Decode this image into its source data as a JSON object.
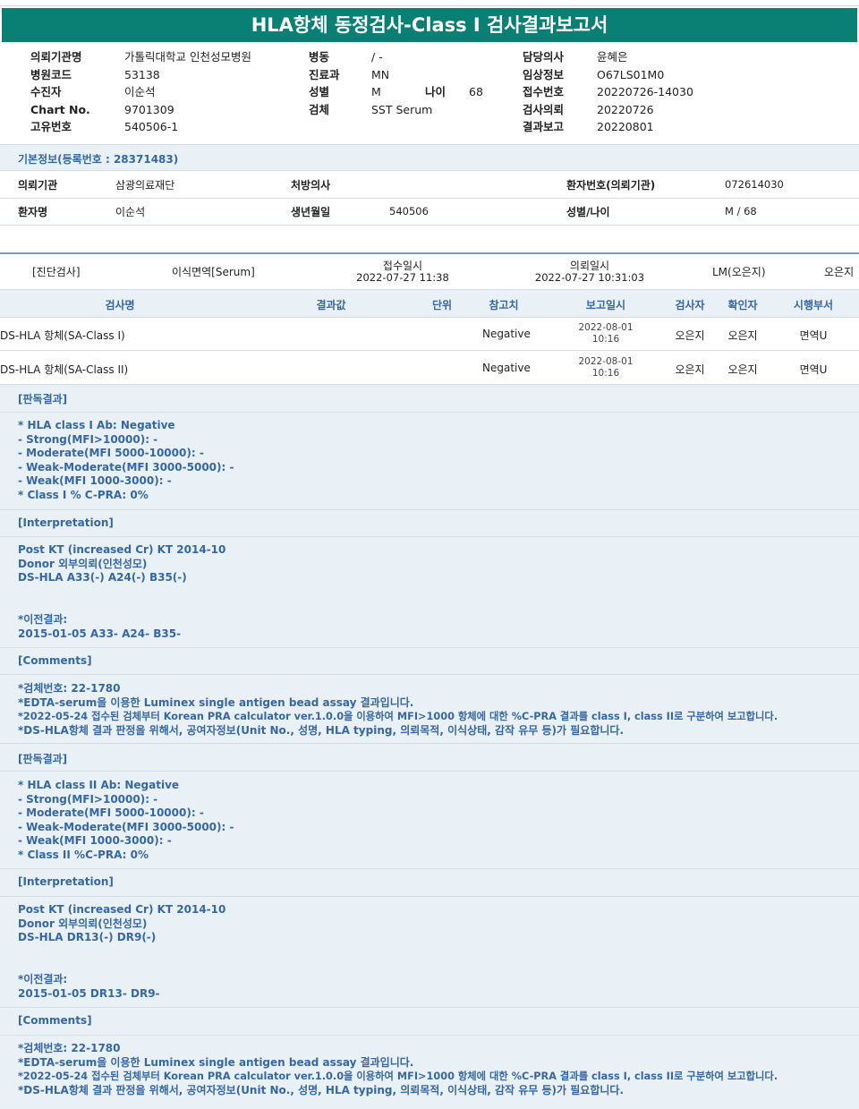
{
  "report_title": "HLA항체 동정검사-Class I 검사결과보고서",
  "header": {
    "col1": [
      {
        "label": "의뢰기관명",
        "value": "가톨릭대학교 인천성모병원"
      },
      {
        "label": "병원코드",
        "value": "53138"
      },
      {
        "label": "수진자",
        "value": "이순석"
      },
      {
        "label": "Chart No.",
        "value": "9701309"
      },
      {
        "label": "고유번호",
        "value": "540506-1"
      }
    ],
    "col2": [
      {
        "label": "병동",
        "value": "/ -"
      },
      {
        "label": "진료과",
        "value": "MN"
      },
      {
        "label": "성별",
        "value": "M"
      },
      {
        "label": "검체",
        "value": "SST Serum"
      }
    ],
    "age_label": "나이",
    "age_value": "68",
    "col3": [
      {
        "label": "담당의사",
        "value": "윤혜은"
      },
      {
        "label": "임상정보",
        "value": "O67LS01M0"
      },
      {
        "label": "접수번호",
        "value": "20220726-14030"
      },
      {
        "label": "검사의뢰",
        "value": "20220726"
      },
      {
        "label": "결과보고",
        "value": "20220801"
      }
    ]
  },
  "basic_info": {
    "title": "기본정보(등록번호 : 28371483)",
    "requester_label": "의뢰기관",
    "requester_value": "삼광의료재단",
    "doctor_label": "처방의사",
    "doctor_value": "",
    "patient_no_label": "환자번호(의뢰기관)",
    "patient_no_value": "072614030",
    "patient_name_label": "환자명",
    "patient_name_value": "이순석",
    "birth_label": "생년월일",
    "birth_value": "540506",
    "sex_age_label": "성별/나이",
    "sex_age_value": "M / 68"
  },
  "exam_info": {
    "category": "[진단검사]",
    "specimen": "이식면역[Serum]",
    "received_label": "접수일시",
    "received_value": "2022-07-27  11:38",
    "requested_label": "의뢰일시",
    "requested_value": "2022-07-27  10:31:03",
    "lm": "LM(오은지)",
    "examiner": "오은지"
  },
  "table": {
    "headers": [
      "검사명",
      "결과값",
      "단위",
      "참고치",
      "보고일시",
      "검사자",
      "확인자",
      "시행부서"
    ],
    "rows": [
      {
        "name": "DS-HLA 항체(SA-Class I)",
        "result": "",
        "unit": "",
        "reference": "Negative",
        "date": "2022-08-01",
        "time": "10:16",
        "tester": "오은지",
        "confirmer": "오은지",
        "dept": "면역U"
      },
      {
        "name": "DS-HLA 항체(SA-Class II)",
        "result": "",
        "unit": "",
        "reference": "Negative",
        "date": "2022-08-01",
        "time": "10:16",
        "tester": "오은지",
        "confirmer": "오은지",
        "dept": "면역U"
      }
    ]
  },
  "sections": {
    "s1_title": "[판독결과]",
    "s1_lines": [
      "* HLA class I Ab: Negative",
      "- Strong(MFI>10000): -",
      "- Moderate(MFI 5000-10000): -",
      "- Weak-Moderate(MFI 3000-5000): -",
      "- Weak(MFI 1000-3000): -",
      "* Class I % C-PRA: 0%"
    ],
    "s2_title": "[Interpretation]",
    "s2_lines": [
      "Post KT (increased Cr) KT 2014-10",
      "Donor 외부의뢰(인천성모)",
      "DS-HLA A33(-) A24(-) B35(-)",
      "",
      "",
      "*이전결과:",
      "2015-01-05 A33- A24- B35-"
    ],
    "s3_title": "[Comments]",
    "s3_lines": [
      "*검체번호: 22-1780",
      "*EDTA-serum을 이용한 Luminex single antigen bead assay 결과입니다.",
      "*2022-05-24 접수된 검체부터 Korean PRA calculator ver.1.0.0을 이용하여 MFI>1000 항체에 대한 %C-PRA 결과를 class I, class II로 구분하여 보고합니다.",
      "*DS-HLA항체 결과 판정을 위해서, 공여자정보(Unit No., 성명, HLA typing, 의뢰목적, 이식상태, 감작 유무 등)가 필요합니다."
    ],
    "s4_title": "[판독결과]",
    "s4_lines": [
      "* HLA class II Ab: Negative",
      "- Strong(MFI>10000): -",
      "- Moderate(MFI 5000-10000): -",
      "- Weak-Moderate(MFI 3000-5000): -",
      "- Weak(MFI 1000-3000): -",
      "* Class II %C-PRA: 0%"
    ],
    "s5_title": "[Interpretation]",
    "s5_lines": [
      "Post KT (increased Cr) KT 2014-10",
      "Donor 외부의뢰(인천성모)",
      "DS-HLA DR13(-) DR9(-)",
      "",
      "",
      "*이전결과:",
      "2015-01-05 DR13- DR9-"
    ],
    "s6_title": "[Comments]",
    "s6_lines": [
      "*검체번호: 22-1780",
      "*EDTA-serum을 이용한 Luminex single antigen bead assay 결과입니다.",
      "*2022-05-24 접수된 검체부터 Korean PRA calculator ver.1.0.0을 이용하여 MFI>1000 항체에 대한 %C-PRA 결과를 class I, class II로 구분하여 보고합니다.",
      "*DS-HLA항체 결과 판정을 위해서, 공여자정보(Unit No., 성명, HLA typing, 의뢰목적, 이식상태, 감작 유무 등)가 필요합니다."
    ]
  }
}
